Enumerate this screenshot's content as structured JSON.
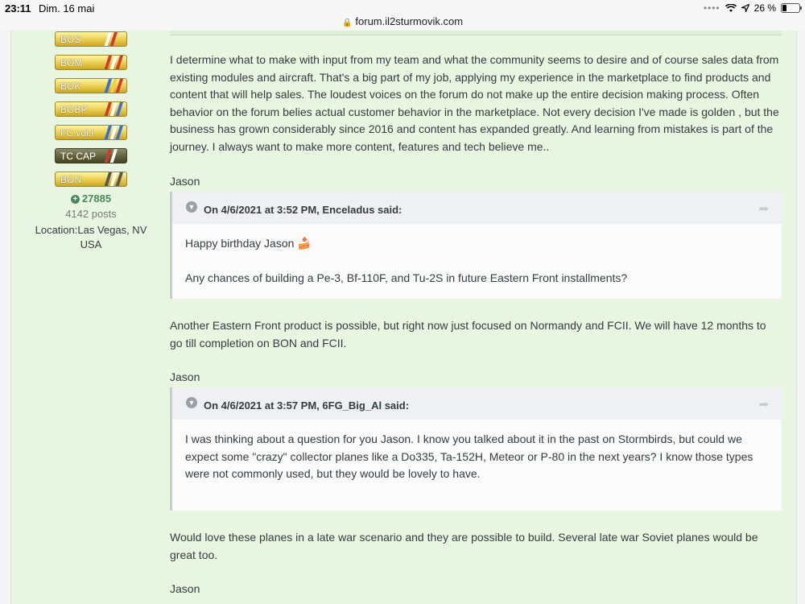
{
  "status_bar": {
    "time": "23:11",
    "date": "Dim. 16 mai",
    "url": "forum.il2sturmovik.com",
    "battery": "26 %",
    "battery_level": 0.26
  },
  "author": {
    "badges": [
      {
        "label": "BOS",
        "style": "gold"
      },
      {
        "label": "BOM",
        "style": "gold"
      },
      {
        "label": "BOK",
        "style": "gold"
      },
      {
        "label": "BOBP",
        "style": "gold"
      },
      {
        "label": "FC vol.I",
        "style": "gold"
      },
      {
        "label": "TC CAP",
        "style": "dark"
      },
      {
        "label": "BON",
        "style": "gold"
      }
    ],
    "reputation": "27885",
    "posts": "4142 posts",
    "location": "Location:Las Vegas, NV USA"
  },
  "post": {
    "paragraph_1": "I determine what to make with input from my team and what the community seems to desire and of course sales data from existing modules and aircraft. That's a big part of my job, applying my experience in the marketplace to find products and content that will help sales. The loudest voices on the forum do not make up the entire decision making process. Often behavior on the forum belies actual customer behavior in the marketplace. Not every decision I've made is golden , but the business has grown considerably since 2016 and content has expanded greatly. And learning from mistakes is part of the journey. I always want to make more content, features and tech believe me..",
    "signature_1": "Jason",
    "quote_1": {
      "header": "On 4/6/2021 at 3:52 PM, Enceladus said:",
      "line_1": "Happy birthday Jason 🍰",
      "line_2": "Any chances of building a Pe-3, Bf-110F, and Tu-2S in future Eastern Front installments?"
    },
    "paragraph_2": "Another Eastern Front product is possible, but right now just focused on Normandy and FCII. We will have 12 months to go till completion on BON and FCII.",
    "signature_2": "Jason",
    "quote_2": {
      "header": "On 4/6/2021 at 3:57 PM, 6FG_Big_Al said:",
      "line_1": "I was thinking about a question for you Jason. I know you talked about it in the past on Stormbirds, but could we expect some \"crazy\" collector planes like a Do335, Ta-152H, Meteor or P-80 in the next years? I know those types were not commonly used, but they would be lovely to have."
    },
    "paragraph_3": "Would love these planes in a late war scenario and they are possible to build. Several late war Soviet planes would be great too.",
    "signature_3": "Jason"
  },
  "colors": {
    "post_background": "#e8f5e0",
    "reputation": "#4a8a5a",
    "quote_header": "#eef0f3"
  }
}
